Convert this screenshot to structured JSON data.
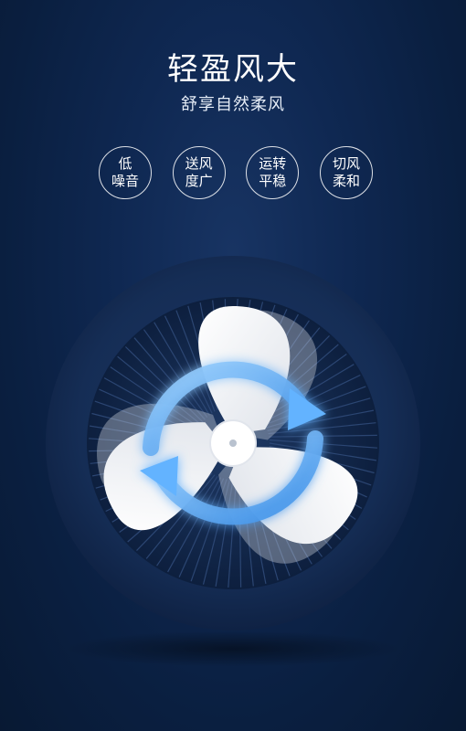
{
  "header": {
    "title": "轻盈风大",
    "subtitle": "舒享自然柔风"
  },
  "features": [
    {
      "line1": "低",
      "line2": "噪音"
    },
    {
      "line1": "送风",
      "line2": "度广"
    },
    {
      "line1": "运转",
      "line2": "平稳"
    },
    {
      "line1": "切风",
      "line2": "柔和"
    }
  ],
  "colors": {
    "background": "#0f2852",
    "fan_rim": "#152d55",
    "blade": "#f0f1f3",
    "airflow_glow": "#5fb1ff"
  },
  "icons": {
    "fan": "fan-illustration",
    "airflow": "rotation-arrows"
  }
}
